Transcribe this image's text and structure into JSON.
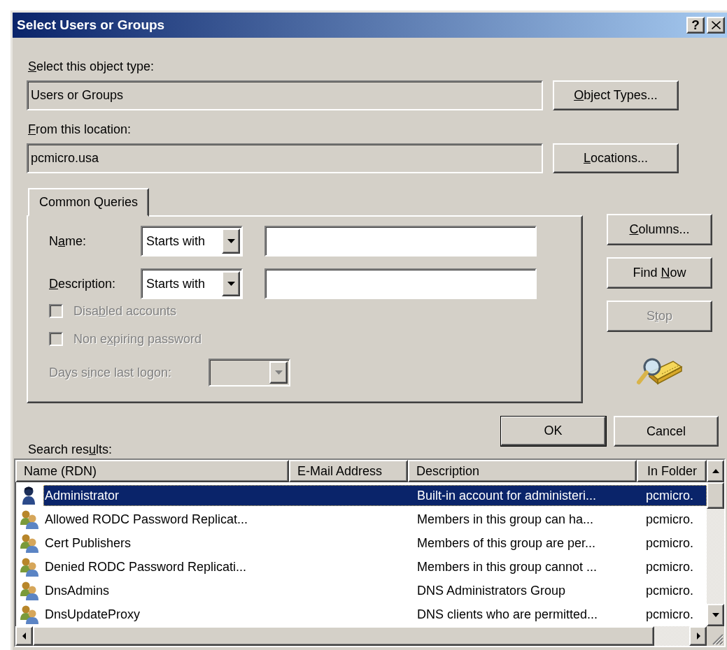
{
  "window": {
    "title": "Select Users or Groups",
    "help_button": "?"
  },
  "object_type": {
    "label": {
      "key": "S",
      "post": "elect this object type:"
    },
    "value": "Users or Groups",
    "button": {
      "key": "O",
      "post": "bject Types..."
    }
  },
  "location": {
    "label": {
      "key": "F",
      "post": "rom this location:"
    },
    "value": "pcmicro.usa",
    "button": {
      "key": "L",
      "post": "ocations..."
    }
  },
  "tabs": [
    {
      "label": "Common Queries",
      "selected": true
    }
  ],
  "queries": [
    {
      "label": {
        "pre": "N",
        "key": "a",
        "post": "me:"
      },
      "operator": "Starts with"
    },
    {
      "label": {
        "key": "D",
        "post": "escription:"
      },
      "operator": "Starts with"
    }
  ],
  "options": [
    {
      "label": {
        "pre": "Disa",
        "key": "b",
        "post": "led accounts"
      },
      "checked": false,
      "disabled": true
    },
    {
      "label": {
        "pre": "Non e",
        "key": "x",
        "post": "piring password"
      },
      "checked": false,
      "disabled": true
    }
  ],
  "days_since_last_logon": {
    "label": {
      "pre": "Days s",
      "key": "i",
      "post": "nce last logon:"
    },
    "disabled": true
  },
  "side_buttons": [
    {
      "label": {
        "key": "C",
        "post": "olumns..."
      },
      "disabled": false
    },
    {
      "label": {
        "pre": "Find ",
        "key": "N",
        "post": "ow"
      },
      "disabled": false
    },
    {
      "label": {
        "pre": "S",
        "key": "t",
        "post": "op"
      },
      "disabled": true
    }
  ],
  "dialog_buttons": [
    {
      "label": "OK",
      "default": true
    },
    {
      "label": "Cancel",
      "default": false
    }
  ],
  "results": {
    "label": {
      "pre": "Search res",
      "key": "u",
      "post": "lts:"
    },
    "columns": [
      "Name (RDN)",
      "E-Mail Address",
      "Description",
      "In Folder"
    ],
    "rows": [
      {
        "kind": "user",
        "name": "Administrator",
        "description": "Built-in account for administeri...",
        "folder": "pcmicro.",
        "selected": true
      },
      {
        "kind": "group",
        "name": "Allowed RODC Password Replicat...",
        "description": "Members in this group can ha...",
        "folder": "pcmicro.",
        "selected": false
      },
      {
        "kind": "group",
        "name": "Cert Publishers",
        "description": "Members of this group are per...",
        "folder": "pcmicro.",
        "selected": false
      },
      {
        "kind": "group",
        "name": "Denied RODC Password Replicati...",
        "description": "Members in this group cannot ...",
        "folder": "pcmicro.",
        "selected": false
      },
      {
        "kind": "group",
        "name": "DnsAdmins",
        "description": "DNS Administrators Group",
        "folder": "pcmicro.",
        "selected": false
      },
      {
        "kind": "group",
        "name": "DnsUpdateProxy",
        "description": "DNS clients who are permitted...",
        "folder": "pcmicro.",
        "selected": false
      }
    ]
  }
}
